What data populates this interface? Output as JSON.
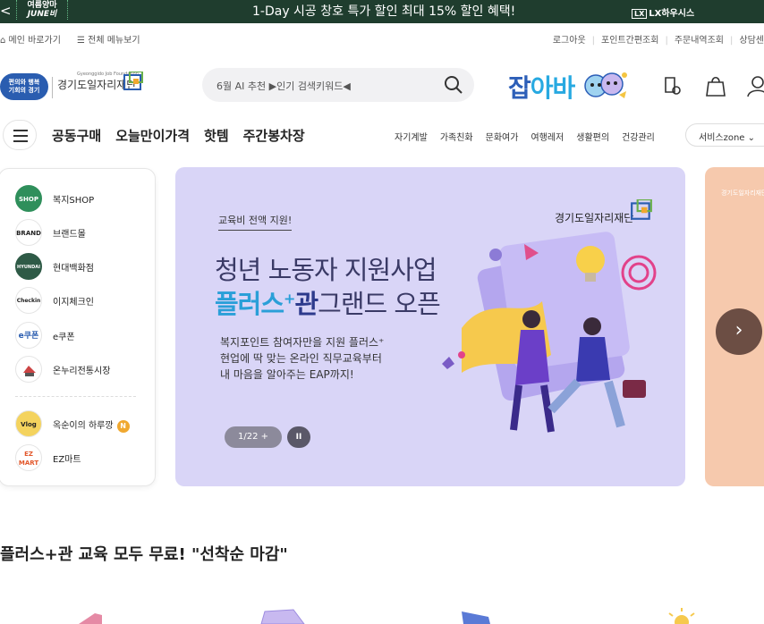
{
  "topbar": {
    "prev_glyph": "<",
    "june_line1": "여름양마",
    "june_line2": "JUNE비",
    "promo": "1-Day 시공 창호 특가 할인  최대 15% 할인 혜택!",
    "lx_mark": "LX",
    "lx_label": "LX하우시스",
    "bg_color": "#1f3d2e"
  },
  "util": {
    "home": "메인 바로가기",
    "menu_all": "전체 메뉴보기",
    "right_links": [
      "로그아웃",
      "포인트간편조회",
      "주문내역조회",
      "상담센"
    ]
  },
  "header": {
    "badge_line1": "편의와 행복",
    "badge_line2": "기회의 경기",
    "foundation_small": "Gyeonggido Job Foundation",
    "foundation": "경기도일자리재단",
    "search_placeholder": "6월 AI 추천 ▶인기 검색키워드◀",
    "brand_part1": "잡",
    "brand_part2": "아바",
    "icons": [
      "search-icon",
      "bell-icon",
      "bag-icon",
      "user-icon"
    ]
  },
  "nav": {
    "main": [
      "공동구매",
      "오늘만이가격",
      "핫템",
      "주간봉차장"
    ],
    "sub": [
      "자기계발",
      "가족친화",
      "문화여가",
      "여행레저",
      "생활편의",
      "건강관리"
    ],
    "service_zone": "서비스zone"
  },
  "quick_menu": {
    "items": [
      {
        "icon_text": "SHOP",
        "label": "복지SHOP"
      },
      {
        "icon_text": "BRAND",
        "label": "브랜드몰"
      },
      {
        "icon_text": "HYUNDAI",
        "label": "현대백화점"
      },
      {
        "icon_text": "Checkin",
        "label": "이지체크인"
      },
      {
        "icon_text": "e쿠폰",
        "label": "e쿠폰"
      },
      {
        "icon_text": "",
        "label": "온누리전통시장"
      }
    ],
    "extra": [
      {
        "icon_text": "Vlog",
        "label": "옥순이의 하루깡",
        "badge": "N"
      },
      {
        "icon_text": "EZ MART",
        "label": "EZ마트"
      }
    ]
  },
  "banner": {
    "pill": "교육비 전액 지원!",
    "logo": "경기도일자리재단",
    "title_line1": "청년 노동자 지원사업",
    "title_plus": "플러스",
    "title_sup": "+",
    "title_gwan": "관",
    "title_rest": "그랜드 오픈",
    "desc_lines": [
      "복지포인트 참여자만을 지원 플러스⁺",
      "현업에 딱 맞는 온라인 직무교육부터",
      "내 마음을 알아주는 EAP까지!"
    ],
    "counter": "1/22 +",
    "pause": "II",
    "bg_color": "#d9d5f7"
  },
  "peek_banner": {
    "text": "경기도일자리재단"
  },
  "next_glyph": "›",
  "section": {
    "title": "플러스+관 교육 모두 무료! \"선착순 마감\""
  }
}
